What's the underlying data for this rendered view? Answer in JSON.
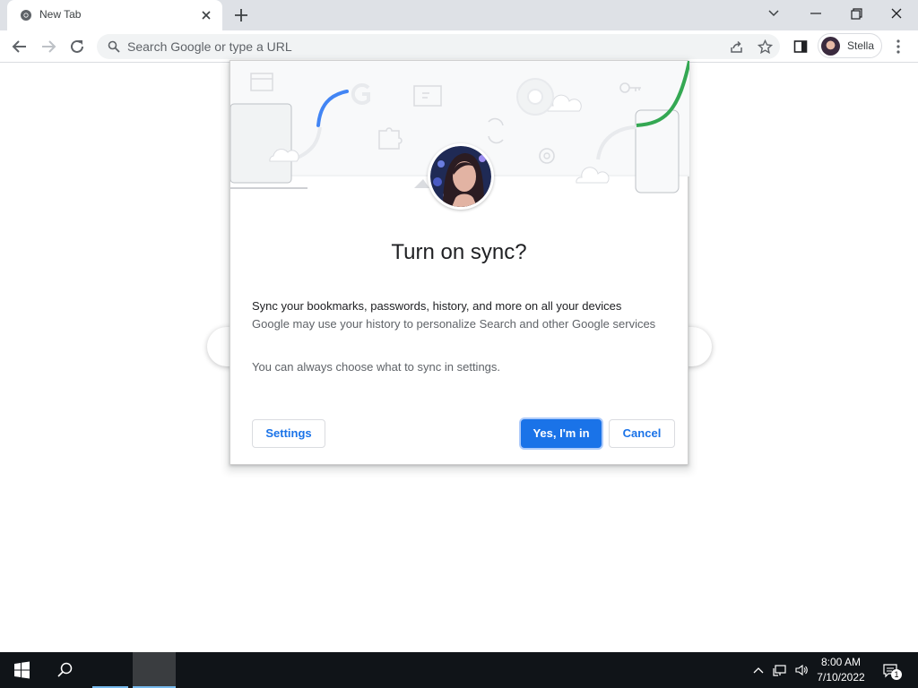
{
  "browser": {
    "tab": {
      "title": "New Tab"
    },
    "omnibox": {
      "placeholder": "Search Google or type a URL"
    },
    "profile": {
      "name": "Stella"
    }
  },
  "dialog": {
    "title": "Turn on sync?",
    "line1": "Sync your bookmarks, passwords, history, and more on all your devices",
    "line2": "Google may use your history to personalize Search and other Google services",
    "line3": "You can always choose what to sync in settings.",
    "buttons": {
      "settings": "Settings",
      "confirm": "Yes, I'm in",
      "cancel": "Cancel"
    }
  },
  "taskbar": {
    "time": "8:00 AM",
    "date": "7/10/2022",
    "notification_count": "1"
  },
  "colors": {
    "accent": "#1a73e8",
    "tabstrip": "#dee1e6",
    "taskbar": "#101418",
    "illustration_green": "#34a853"
  }
}
